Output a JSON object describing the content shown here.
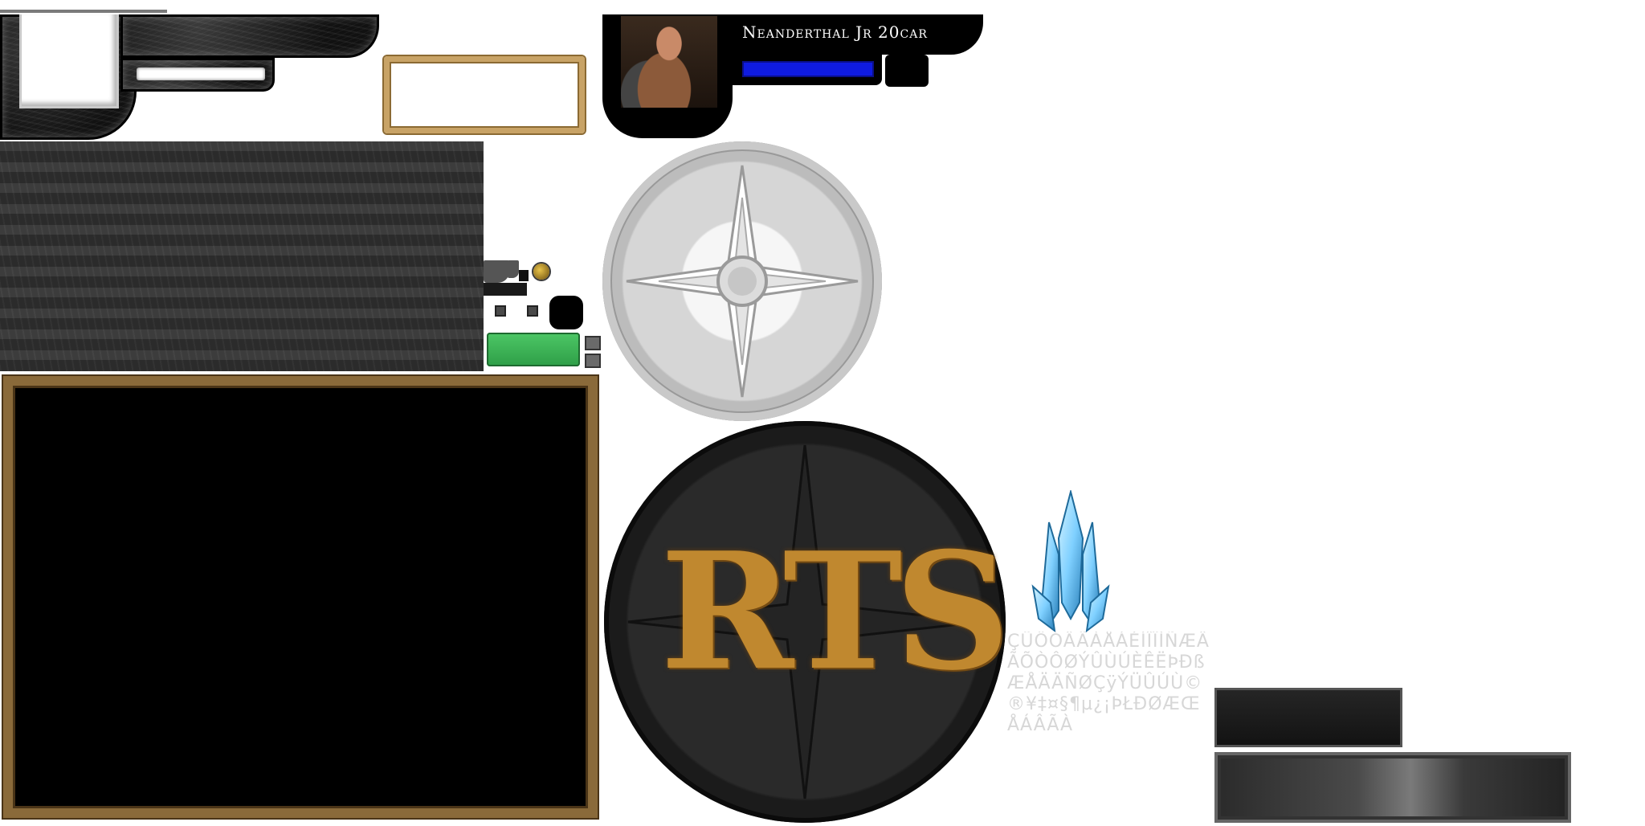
{
  "hud": {
    "player_name": "Neanderthal Jr 20car",
    "mana_color": "#0f1be0"
  },
  "logo": {
    "text": "RTS",
    "color": "#c0882f"
  },
  "font_atlas": {
    "glyphs": "ÇÜÖÓÂÄÀÅÁÉÍÎÏÌÑÆÂÃÕÒÔØÝÛÙÚÈÊËÞÐßÆÅÄÄÑØÇÿÝÜÛÚÙ©®¥‡¤§¶µ¿¡ÞŁÐØÆŒÅÁÂÃÀ"
  },
  "colors": {
    "green_button": "#3dbb57",
    "gold_frame": "#c8a366",
    "crystal": "#7fd0ff"
  },
  "icons": {
    "crystal": "crystal-icon",
    "gold_orb": "gold-orb-icon",
    "compass": "compass-icon",
    "rts_emblem": "rts-emblem-icon"
  }
}
